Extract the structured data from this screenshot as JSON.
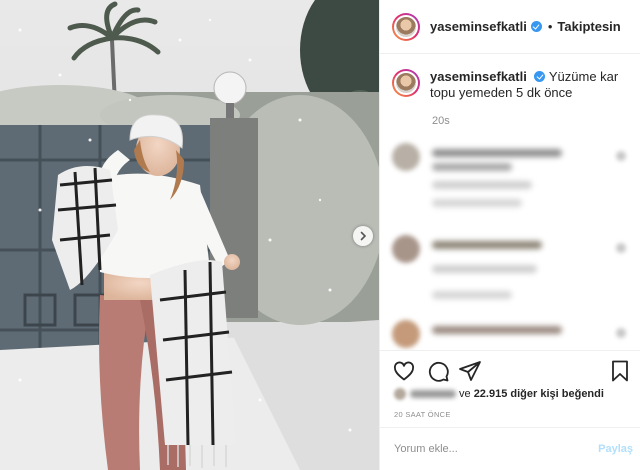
{
  "post": {
    "username": "yaseminsefkatli",
    "follow_status": "Takiptesin",
    "separator": "•",
    "caption": "Yüzüme kar topu yemeden 5 dk önce",
    "caption_time": "20s"
  },
  "likes": {
    "prefix": "ve",
    "count": "22.915",
    "suffix": "diğer kişi beğendi"
  },
  "date": "20 SAAT ÖNCE",
  "comment_box": {
    "placeholder": "Yorum ekle...",
    "share_label": "Paylaş"
  },
  "icons": [
    "verified-badge-icon",
    "heart-icon",
    "comment-icon",
    "share-icon",
    "bookmark-icon",
    "chevron-right-icon"
  ],
  "colors": {
    "verified": "#3897f0",
    "share_disabled": "#b2dffc",
    "muted": "#8e8e8e"
  }
}
